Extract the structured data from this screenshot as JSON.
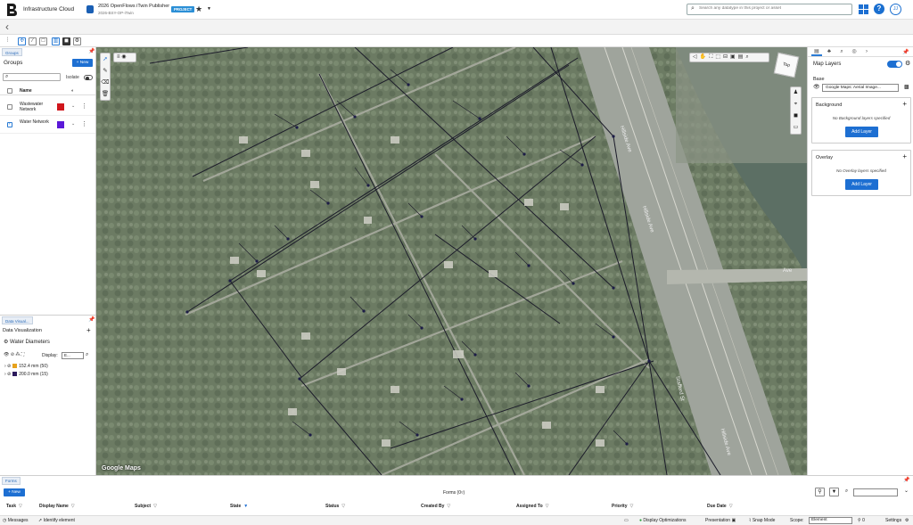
{
  "header": {
    "app_title": "Infrastructure Cloud",
    "project_name": "2026 OpenFlows iTwin Publisher",
    "project_sub": "2026-BSY-OP-iTwin",
    "project_badge": "PROJECT",
    "search_placeholder": "Search any datatype in this project or asset",
    "avatar_initials": "JJ"
  },
  "left_panel": {
    "groups_tab": "Groups",
    "groups_title": "Groups",
    "new_button": "+ New",
    "isolate_label": "Isolate",
    "name_header": "Name",
    "groups": [
      {
        "name": "Wastewater Network",
        "color": "#d0161c",
        "checked": false
      },
      {
        "name": "Water Network",
        "color": "#5b18d8",
        "checked": true
      }
    ],
    "dv_tab": "Data Visual...",
    "dv_title": "Data Visualization",
    "dv_layer": "Water Diameters",
    "display_label": "Display:",
    "display_value": "E...",
    "legend": [
      {
        "label": "152.4 mm (50)",
        "color": "#e7a21c"
      },
      {
        "label": "200.0 mm (15)",
        "color": "#2c1a5c"
      }
    ]
  },
  "map": {
    "attribution": "Google Maps",
    "cube_label": "Top",
    "labels": [
      "Hillside Ave",
      "Hillside Ave",
      "Stafford St",
      "Hillside Ave",
      "Ave"
    ]
  },
  "right_panel": {
    "title": "Map Layers",
    "base_label": "Base",
    "base_value": "Google Maps: Aerial Image...",
    "background_title": "Background",
    "background_empty": "No Background layers specified",
    "overlay_title": "Overlay",
    "overlay_empty": "No Overlay layers specified",
    "add_layer": "Add Layer"
  },
  "forms": {
    "tab": "Forms",
    "title": "Forms (0▿)",
    "new_button": "+ New",
    "columns": [
      "Task",
      "Display Name",
      "Subject",
      "State",
      "Status",
      "Created By",
      "Assigned To",
      "Priority",
      "Due Date"
    ]
  },
  "status_bar": {
    "messages": "Messages",
    "identify": "Identify element",
    "display_opt": "Display Optimizations",
    "presentation": "Presentation",
    "snap": "Snap Mode",
    "scope_label": "Scope:",
    "scope_value": "Element",
    "count": "0",
    "settings": "Settings"
  }
}
